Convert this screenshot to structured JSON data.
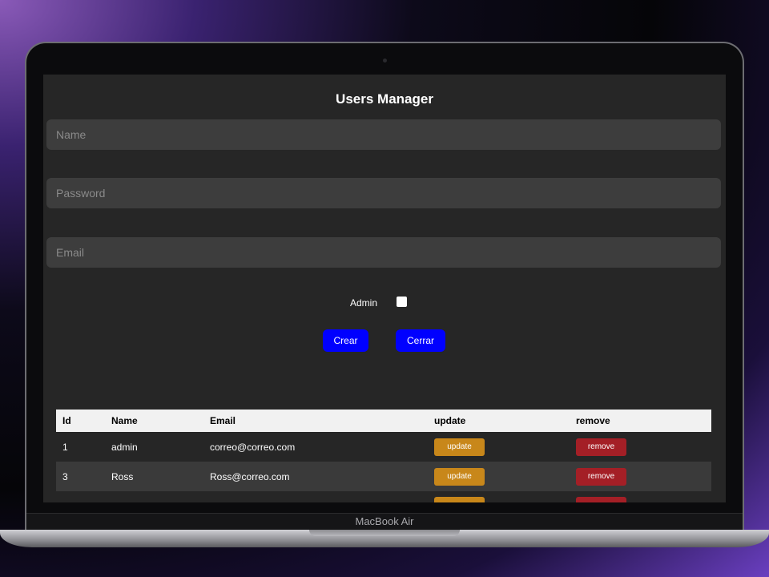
{
  "app": {
    "title": "Users Manager"
  },
  "form": {
    "name_placeholder": "Name",
    "password_placeholder": "Password",
    "email_placeholder": "Email",
    "admin_label": "Admin",
    "admin_checked": false,
    "create_label": "Crear",
    "close_label": "Cerrar"
  },
  "table": {
    "headers": [
      "Id",
      "Name",
      "Email",
      "update",
      "remove"
    ],
    "rows": [
      {
        "id": "1",
        "name": "admin",
        "email": "correo@correo.com",
        "update": "update",
        "remove": "remove"
      },
      {
        "id": "3",
        "name": "Ross",
        "email": "Ross@correo.com",
        "update": "update",
        "remove": "remove"
      }
    ]
  },
  "device": {
    "label": "MacBook Air"
  },
  "colors": {
    "primary_button": "#0000ff",
    "update_button": "#c8871a",
    "remove_button": "#a41f26",
    "screen_background": "#262626"
  }
}
